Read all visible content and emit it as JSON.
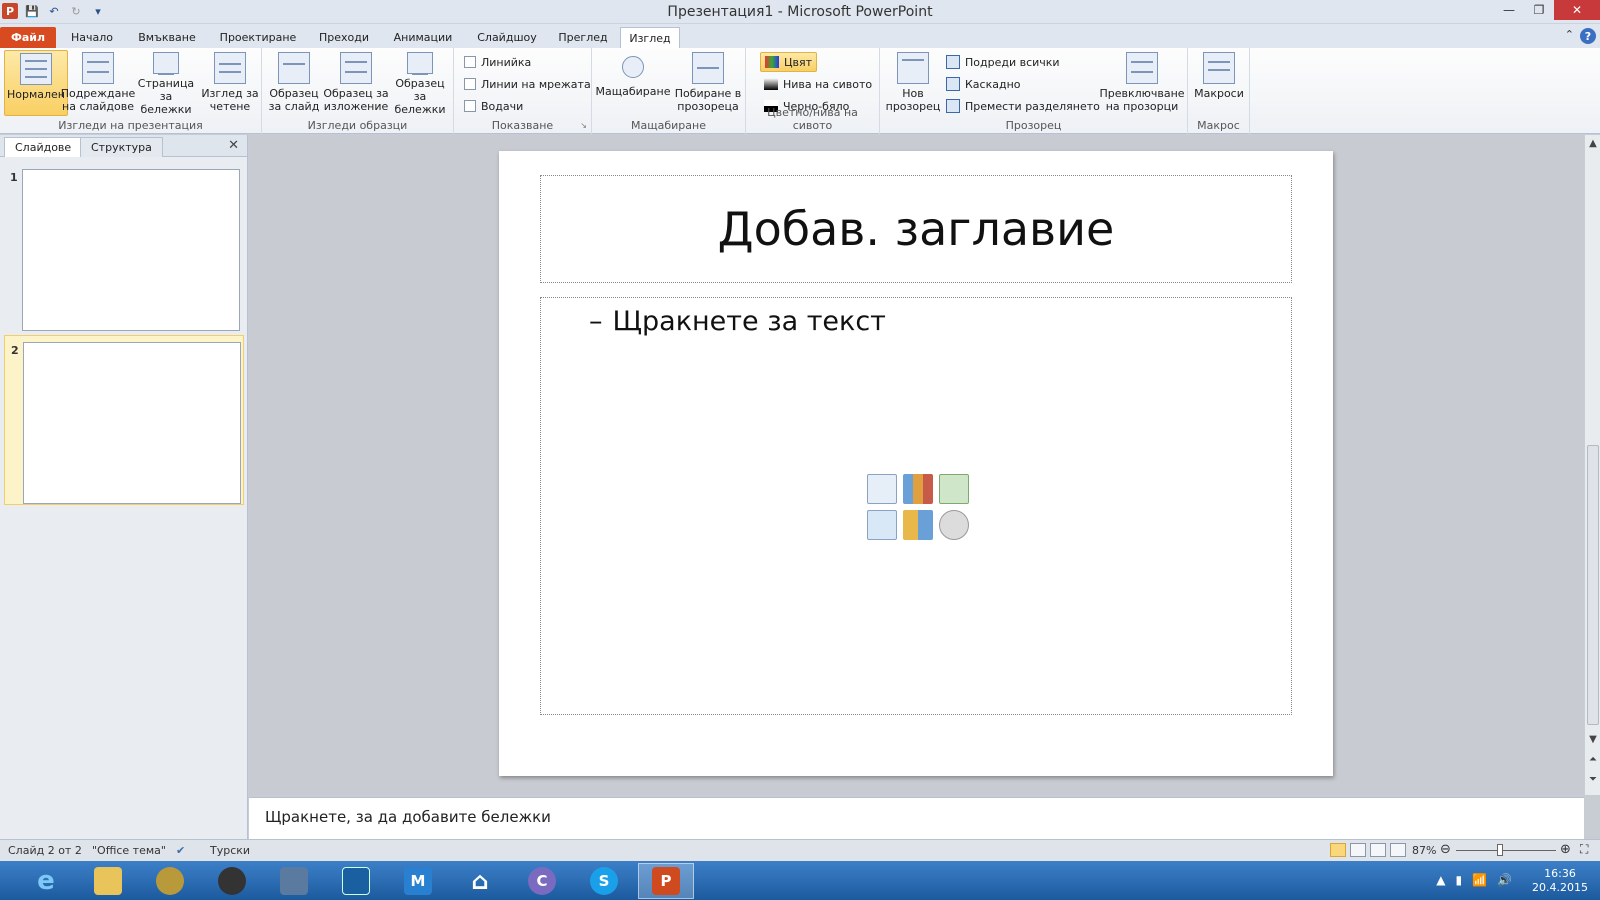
{
  "window": {
    "title": "Презентация1 - Microsoft PowerPoint",
    "controls": {
      "minimize": "—",
      "restore": "❐",
      "close": "✕"
    }
  },
  "qat": {
    "app_icon": "P",
    "save": "💾",
    "undo": "↶",
    "redo": "↻",
    "customize": "▾"
  },
  "tabs": {
    "file": "Файл",
    "items": [
      "Начало",
      "Вмъкване",
      "Проектиране",
      "Преходи",
      "Анимации",
      "Слайдшоу",
      "Преглед",
      "Изглед"
    ],
    "active": "Изглед"
  },
  "ribbon": {
    "group_views": {
      "label": "Изгледи на презентация",
      "normal": "Нормален",
      "slide_sorter": "Подреждане на слайдове",
      "notes_page": "Страница за бележки",
      "reading_view": "Изглед за четене"
    },
    "group_masters": {
      "label": "Изгледи образци",
      "slide_master": "Образец за слайд",
      "handout_master": "Образец за изложение",
      "notes_master": "Образец за бележки"
    },
    "group_show": {
      "label": "Показване",
      "ruler": "Линийка",
      "gridlines": "Линии на мрежата",
      "guides": "Водачи"
    },
    "group_zoom": {
      "label": "Мащабиране",
      "zoom": "Мащабиране",
      "fit": "Побиране в прозореца"
    },
    "group_color": {
      "label": "Цветно/нива на сивото",
      "color": "Цвят",
      "grayscale": "Нива на сивото",
      "bw": "Черно-бяло"
    },
    "group_window": {
      "label": "Прозорец",
      "new_window": "Нов прозорец",
      "arrange_all": "Подреди всички",
      "cascade": "Каскадно",
      "move_split": "Премести разделянето",
      "switch_windows": "Превключване на прозорци"
    },
    "group_macros": {
      "label": "Макрос",
      "macros": "Макроси"
    }
  },
  "leftpanel": {
    "tab_slides": "Слайдове",
    "tab_outline": "Структура",
    "close": "✕",
    "slides": [
      {
        "num": "1"
      },
      {
        "num": "2"
      }
    ],
    "selected_slide": 2
  },
  "slide": {
    "title_placeholder": "Добав. заглавие",
    "bullet": "–",
    "body_placeholder": "Щракнете за текст"
  },
  "notes": {
    "placeholder": "Щракнете, за да добавите бележки"
  },
  "statusbar": {
    "slide_info": "Слайд 2 от 2",
    "theme": "\"Office тема\"",
    "language": "Турски",
    "zoom": "87%",
    "zoom_level": 0.87
  },
  "taskbar": {
    "apps": [
      "internet-explorer",
      "file-explorer",
      "media-app",
      "speaker-app",
      "document-app",
      "task-app",
      "maxthon",
      "home",
      "browser",
      "skype",
      "powerpoint"
    ],
    "clock_time": "16:36",
    "clock_date": "20.4.2015"
  },
  "colors": {
    "file_tab": "#d84b21",
    "selected": "#f9cf63",
    "taskbar": "#2a6bb5"
  }
}
